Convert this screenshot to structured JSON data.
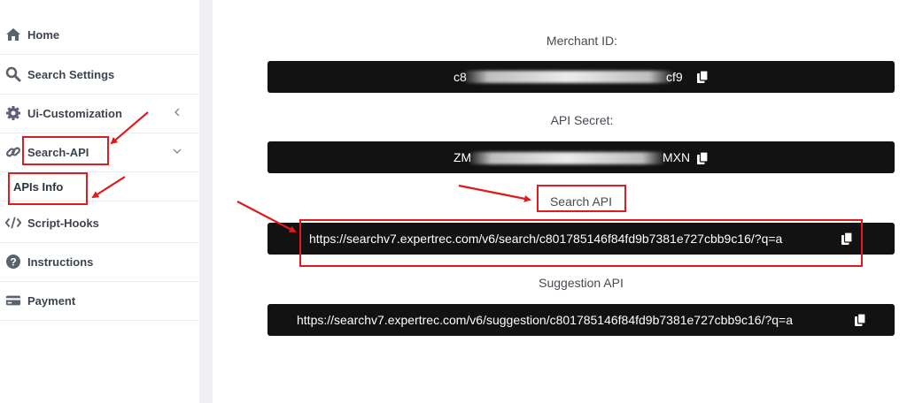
{
  "sidebar": {
    "items": [
      {
        "label": "Home",
        "icon": "home-icon"
      },
      {
        "label": "Search Settings",
        "icon": "search-icon"
      },
      {
        "label": "Ui-Customization",
        "icon": "gear-icon",
        "chevron": "chevron-left-icon"
      },
      {
        "label": "Search-API",
        "icon": "link-icon",
        "chevron": "chevron-down-icon"
      },
      {
        "label": "Script-Hooks",
        "icon": "code-icon"
      },
      {
        "label": "Instructions",
        "icon": "question-circle-icon"
      },
      {
        "label": "Payment",
        "icon": "credit-card-icon"
      }
    ],
    "sub_item": {
      "label": "APIs Info"
    }
  },
  "main": {
    "merchant_id": {
      "label": "Merchant ID:",
      "value_start": "c8",
      "value_end": "cf9"
    },
    "api_secret": {
      "label": "API Secret:",
      "value_start": "ZM",
      "value_end": "MXN"
    },
    "search_api": {
      "label": "Search API",
      "value": "https://searchv7.expertrec.com/v6/search/c801785146f84fd9b7381e727cbb9c16/?q=a"
    },
    "suggestion_api": {
      "label": "Suggestion API",
      "value": "https://searchv7.expertrec.com/v6/suggestion/c801785146f84fd9b7381e727cbb9c16/?q=a"
    }
  },
  "colors": {
    "accent_red": "#e01b1b",
    "bar_bg": "#121212",
    "sidebar_text": "#3d4450"
  }
}
